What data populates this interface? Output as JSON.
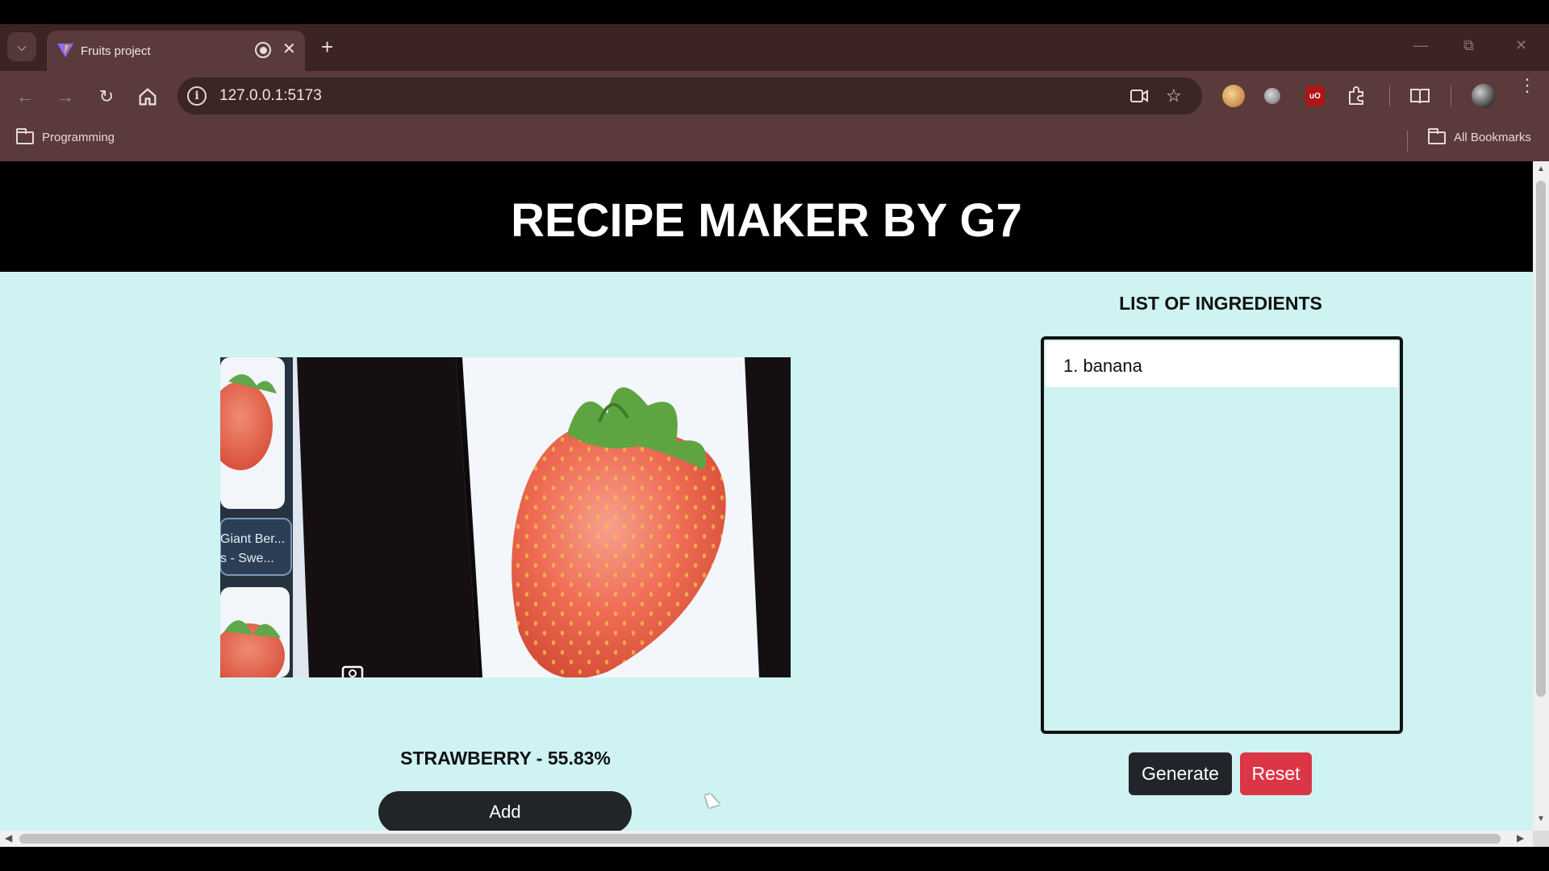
{
  "browser": {
    "tab": {
      "title": "Fruits project",
      "favicon": "vite-logo-icon",
      "status_icon": "recording-icon"
    },
    "url": "127.0.0.1:5173",
    "bookmarks": [
      {
        "label": "Programming",
        "icon": "folder-icon"
      },
      {
        "label": "All Bookmarks",
        "icon": "folder-icon"
      }
    ],
    "window_controls": [
      "minimize-icon",
      "restore-icon",
      "close-icon"
    ],
    "theme_colors": {
      "tab_strip": "#3c2424",
      "toolbar": "#5a3a3a",
      "omnibox": "#3c2525"
    }
  },
  "app": {
    "title": "RECIPE MAKER BY G7",
    "camera_feed": {
      "icon": "camera-switch-icon",
      "overlay_card_lines": [
        "Giant Ber...",
        "s - Swe..."
      ]
    },
    "prediction": "STRAWBERRY - 55.83%",
    "add_label": "Add",
    "list_heading": "LIST OF INGREDIENTS",
    "ingredients": [
      "1. banana"
    ],
    "generate_label": "Generate",
    "reset_label": "Reset",
    "colors": {
      "page_bg": "#cff2f2",
      "header_bg": "#000000",
      "dark_button": "#212529",
      "reset_button": "#dc3545"
    }
  }
}
